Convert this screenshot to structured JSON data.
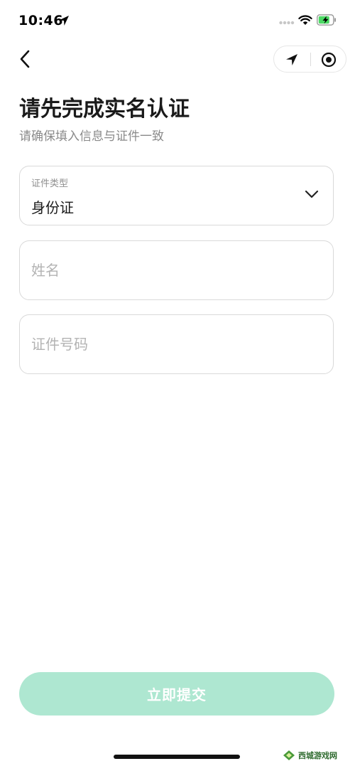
{
  "status_bar": {
    "time": "10:46"
  },
  "nav": {
    "back_icon": "chevron-left-icon",
    "capsule_left_icon": "location-arrow-icon",
    "capsule_right_icon": "record-circle-icon"
  },
  "page": {
    "title": "请先完成实名认证",
    "subtitle": "请确保填入信息与证件一致"
  },
  "form": {
    "id_type": {
      "label": "证件类型",
      "value": "身份证"
    },
    "name": {
      "placeholder": "姓名",
      "value": ""
    },
    "id_number": {
      "placeholder": "证件号码",
      "value": ""
    },
    "submit_label": "立即提交"
  },
  "watermark": {
    "text": "西城游戏网"
  },
  "colors": {
    "accent_disabled": "#aee7d1",
    "battery_green": "#4cd964"
  }
}
